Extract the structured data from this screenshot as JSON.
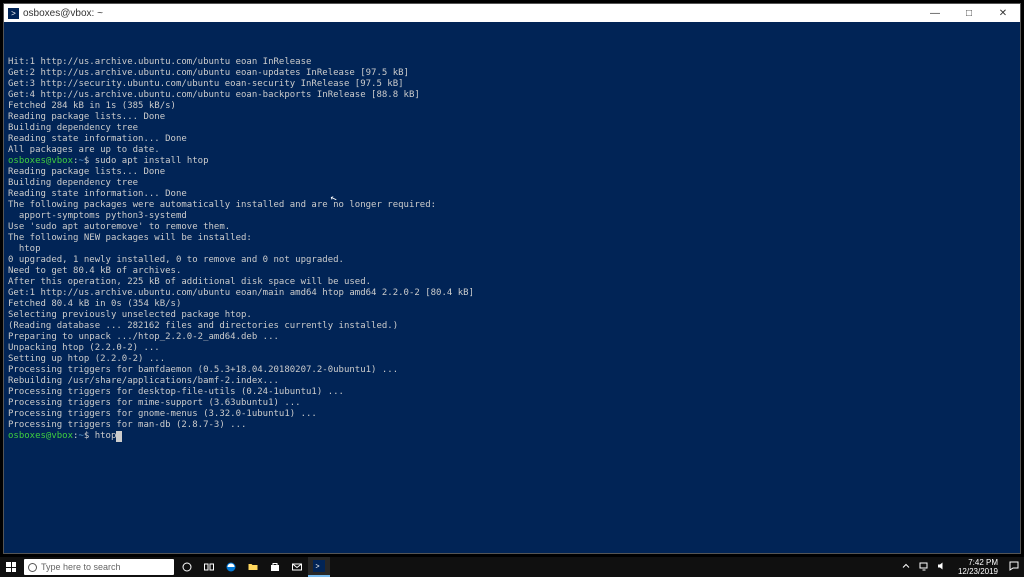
{
  "window": {
    "title": "osboxes@vbox: ~",
    "controls": {
      "min": "—",
      "max": "□",
      "close": "✕"
    }
  },
  "prompt": {
    "user_host": "osboxes@vbox",
    "sep": ":",
    "path": "~",
    "sigil": "$"
  },
  "commands": {
    "install": "sudo apt install htop",
    "current": "htop"
  },
  "lines": [
    "Hit:1 http://us.archive.ubuntu.com/ubuntu eoan InRelease",
    "Get:2 http://us.archive.ubuntu.com/ubuntu eoan-updates InRelease [97.5 kB]",
    "Get:3 http://security.ubuntu.com/ubuntu eoan-security InRelease [97.5 kB]",
    "Get:4 http://us.archive.ubuntu.com/ubuntu eoan-backports InRelease [88.8 kB]",
    "Fetched 284 kB in 1s (385 kB/s)",
    "Reading package lists... Done",
    "Building dependency tree",
    "Reading state information... Done",
    "All packages are up to date.",
    "__PROMPT_INSTALL__",
    "Reading package lists... Done",
    "Building dependency tree",
    "Reading state information... Done",
    "The following packages were automatically installed and are no longer required:",
    "  apport-symptoms python3-systemd",
    "Use 'sudo apt autoremove' to remove them.",
    "The following NEW packages will be installed:",
    "  htop",
    "0 upgraded, 1 newly installed, 0 to remove and 0 not upgraded.",
    "Need to get 80.4 kB of archives.",
    "After this operation, 225 kB of additional disk space will be used.",
    "Get:1 http://us.archive.ubuntu.com/ubuntu eoan/main amd64 htop amd64 2.2.0-2 [80.4 kB]",
    "Fetched 80.4 kB in 0s (354 kB/s)",
    "Selecting previously unselected package htop.",
    "(Reading database ... 282162 files and directories currently installed.)",
    "Preparing to unpack .../htop_2.2.0-2_amd64.deb ...",
    "Unpacking htop (2.2.0-2) ...",
    "Setting up htop (2.2.0-2) ...",
    "Processing triggers for bamfdaemon (0.5.3+18.04.20180207.2-0ubuntu1) ...",
    "Rebuilding /usr/share/applications/bamf-2.index...",
    "Processing triggers for desktop-file-utils (0.24-1ubuntu1) ...",
    "Processing triggers for mime-support (3.63ubuntu1) ...",
    "Processing triggers for gnome-menus (3.32.0-1ubuntu1) ...",
    "Processing triggers for man-db (2.8.7-3) ...",
    "__PROMPT_CURRENT__"
  ],
  "taskbar": {
    "search_placeholder": "Type here to search",
    "clock": {
      "time": "7:42 PM",
      "date": "12/23/2019"
    }
  }
}
